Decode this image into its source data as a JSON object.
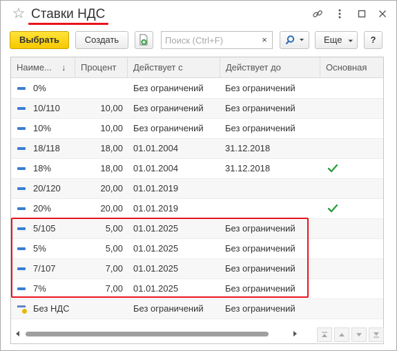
{
  "window": {
    "title": "Ставки НДС"
  },
  "toolbar": {
    "select_label": "Выбрать",
    "create_label": "Создать",
    "search_placeholder": "Поиск (Ctrl+F)",
    "search_clear": "×",
    "search_button_icon": "search-icon",
    "more_label": "Еще",
    "help_label": "?"
  },
  "columns": {
    "name": "Наиме...",
    "sort_indicator": "↓",
    "percent": "Процент",
    "valid_from": "Действует с",
    "valid_to": "Действует до",
    "main": "Основная"
  },
  "rows": [
    {
      "name": "0%",
      "percent": "",
      "valid_from": "Без ограничений",
      "valid_to": "Без ограничений",
      "main": false,
      "icon": "item-dash-icon"
    },
    {
      "name": "10/110",
      "percent": "10,00",
      "valid_from": "Без ограничений",
      "valid_to": "Без ограничений",
      "main": false,
      "icon": "item-dash-icon"
    },
    {
      "name": "10%",
      "percent": "10,00",
      "valid_from": "Без ограничений",
      "valid_to": "Без ограничений",
      "main": false,
      "icon": "item-dash-icon"
    },
    {
      "name": "18/118",
      "percent": "18,00",
      "valid_from": "01.01.2004",
      "valid_to": "31.12.2018",
      "main": false,
      "icon": "item-dash-icon"
    },
    {
      "name": "18%",
      "percent": "18,00",
      "valid_from": "01.01.2004",
      "valid_to": "31.12.2018",
      "main": true,
      "icon": "item-dash-icon"
    },
    {
      "name": "20/120",
      "percent": "20,00",
      "valid_from": "01.01.2019",
      "valid_to": "",
      "main": false,
      "icon": "item-dash-icon"
    },
    {
      "name": "20%",
      "percent": "20,00",
      "valid_from": "01.01.2019",
      "valid_to": "",
      "main": true,
      "icon": "item-dash-icon"
    },
    {
      "name": "5/105",
      "percent": "5,00",
      "valid_from": "01.01.2025",
      "valid_to": "Без ограничений",
      "main": false,
      "icon": "item-dash-icon"
    },
    {
      "name": "5%",
      "percent": "5,00",
      "valid_from": "01.01.2025",
      "valid_to": "Без ограничений",
      "main": false,
      "icon": "item-dash-icon"
    },
    {
      "name": "7/107",
      "percent": "7,00",
      "valid_from": "01.01.2025",
      "valid_to": "Без ограничений",
      "main": false,
      "icon": "item-dash-icon"
    },
    {
      "name": "7%",
      "percent": "7,00",
      "valid_from": "01.01.2025",
      "valid_to": "Без ограничений",
      "main": false,
      "icon": "item-dash-icon"
    },
    {
      "name": "Без НДС",
      "percent": "",
      "valid_from": "Без ограничений",
      "valid_to": "Без ограничений",
      "main": false,
      "icon": "item-no-vat-icon"
    }
  ],
  "colors": {
    "accent_red": "#e8121b",
    "primary_yellow": "#f5c800",
    "check_green": "#2e9e3e",
    "item_blue": "#3a7dd4"
  }
}
